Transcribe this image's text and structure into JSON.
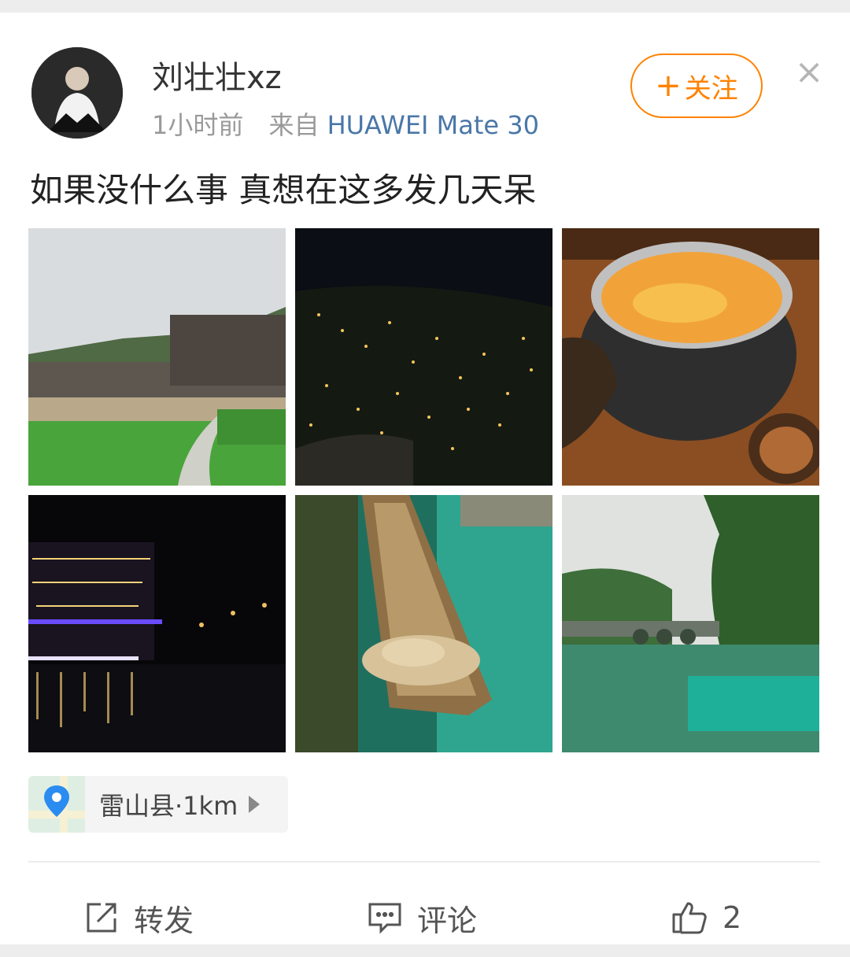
{
  "post": {
    "author": "刘壮壮xz",
    "time": "1小时前",
    "source_prefix": "来自",
    "device": "HUAWEI Mate 30",
    "follow_label": "关注",
    "follow_plus": "+",
    "close": "×",
    "text": "如果没什么事 真想在这多发几天呆"
  },
  "location": {
    "label": "雷山县·1km"
  },
  "actions": {
    "repost_label": "转发",
    "comment_label": "评论",
    "like_count": "2"
  },
  "colors": {
    "accent": "#ff8200",
    "device_link": "#4a77a8"
  },
  "icons": {
    "repost": "share-icon",
    "comment": "comment-icon",
    "like": "thumbs-up-icon",
    "location": "location-pin-icon"
  },
  "photos": [
    {
      "name": "village-field-photo"
    },
    {
      "name": "village-night-photo"
    },
    {
      "name": "hotpot-photo"
    },
    {
      "name": "river-night-photo"
    },
    {
      "name": "boat-hat-photo"
    },
    {
      "name": "green-river-bridge-photo"
    }
  ]
}
